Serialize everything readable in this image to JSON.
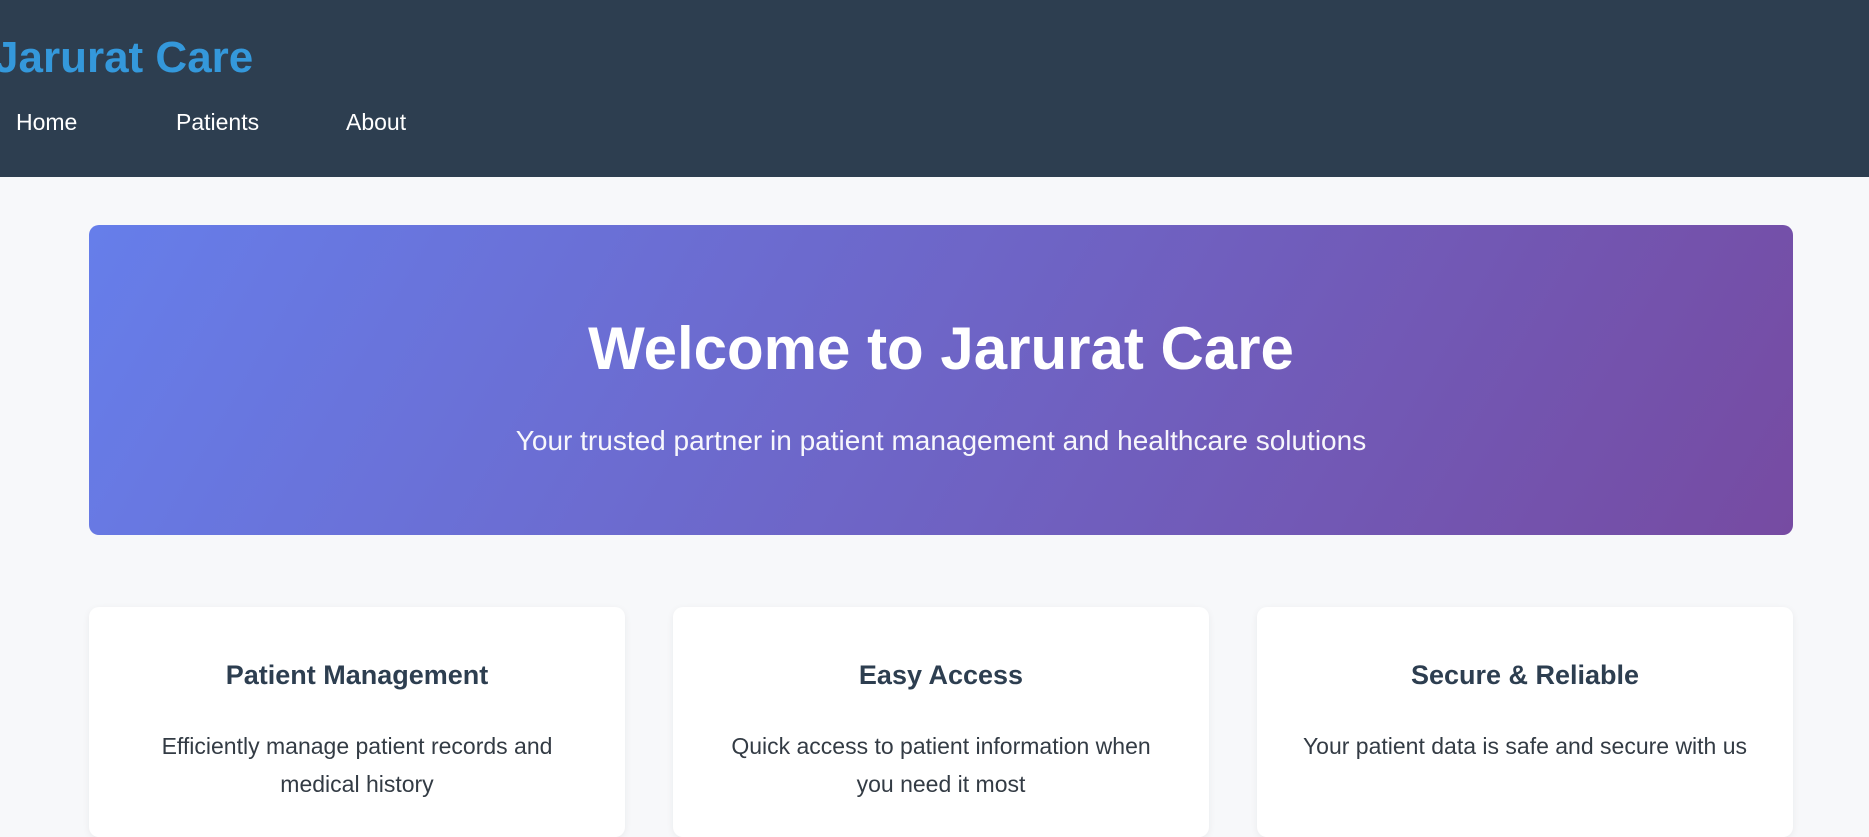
{
  "header": {
    "brand": "Jarurat Care",
    "nav": [
      {
        "label": "Home"
      },
      {
        "label": "Patients"
      },
      {
        "label": "About"
      }
    ]
  },
  "hero": {
    "title": "Welcome to Jarurat Care",
    "subtitle": "Your trusted partner in patient management and healthcare solutions",
    "gradient_start": "#667eea",
    "gradient_end": "#764ba2"
  },
  "features": [
    {
      "title": "Patient Management",
      "text": "Efficiently manage patient records and medical history"
    },
    {
      "title": "Easy Access",
      "text": "Quick access to patient information when you need it most"
    },
    {
      "title": "Secure & Reliable",
      "text": "Your patient data is safe and secure with us"
    }
  ],
  "colors": {
    "navbar": "#2d3e50",
    "brand": "#3498db",
    "page_bg": "#f7f8fa"
  }
}
